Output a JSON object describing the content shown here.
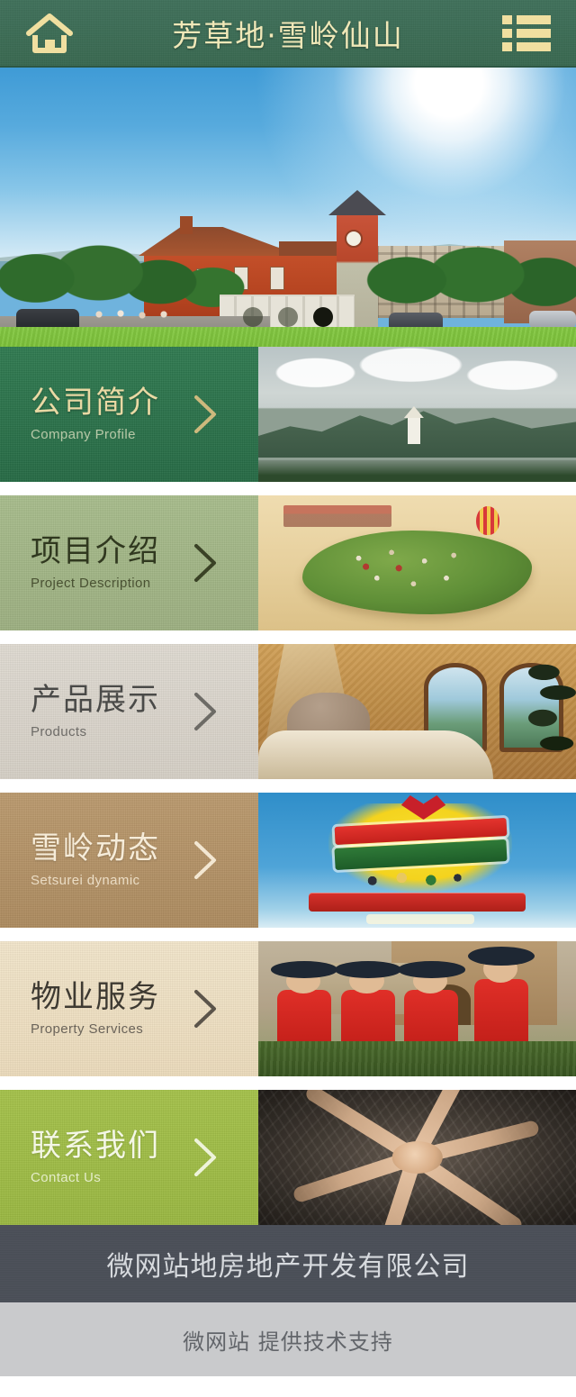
{
  "header": {
    "title": "芳草地·雪岭仙山",
    "home_icon": "home-icon",
    "menu_icon": "list-menu-icon",
    "bg_color": "#3a6b55",
    "title_color": "#f0e8b8"
  },
  "hero": {
    "alt": "雪岭仙山西班牙风情小镇全景",
    "dots": [
      {
        "label": "1",
        "active": false
      },
      {
        "label": "2",
        "active": false
      },
      {
        "label": "3",
        "active": true
      }
    ]
  },
  "cards": [
    {
      "cn": "公司简介",
      "en": "Company Profile",
      "theme": "t-green",
      "thumb": "th-mountain",
      "thumb_alt": "群山环绕的小镇远景",
      "accent": "#2f7a50"
    },
    {
      "cn": "项目介绍",
      "en": "Project Description",
      "theme": "t-sage",
      "thumb": "th-map",
      "thumb_alt": "重庆最像西班牙风情主题小镇手绘鸟瞰图",
      "accent": "#a8bd8c"
    },
    {
      "cn": "产品展示",
      "en": "Products",
      "theme": "t-stone",
      "thumb": "th-bedroom",
      "thumb_alt": "样板间卧室实景",
      "accent": "#e0dbd2"
    },
    {
      "cn": "雪岭动态",
      "en": "Setsurei dynamic",
      "theme": "t-tan",
      "thumb": "th-poster",
      "thumb_alt": "向青春梦想致敬 为休闲假日喝彩 活动海报",
      "accent": "#bb9a6e"
    },
    {
      "cn": "物业服务",
      "en": "Property Services",
      "theme": "t-cream",
      "thumb": "th-guards",
      "thumb_alt": "红色制服保安敬礼",
      "accent": "#f3e6cb"
    },
    {
      "cn": "联系我们",
      "en": "Contact Us",
      "theme": "t-lime",
      "thumb": "th-hands",
      "thumb_alt": "团队叠手合作",
      "accent": "#a5c24a"
    }
  ],
  "footer": {
    "company": "微网站地房地产开发有限公司",
    "credit": "微网站 提供技术支持",
    "top_bg": "#4a4f58",
    "bottom_bg": "#c9cacc"
  }
}
